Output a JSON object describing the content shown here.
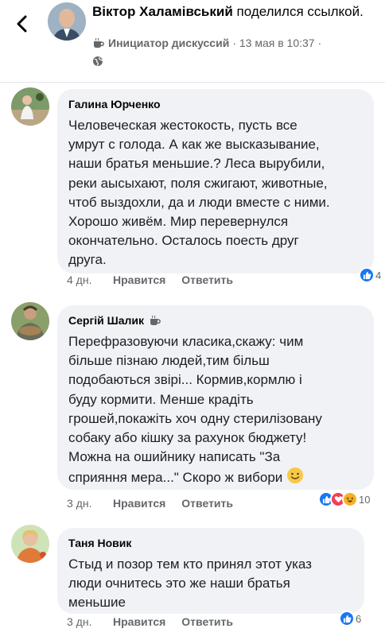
{
  "header": {
    "author": "Віктор Халамівський",
    "action": "поделился ссылкой.",
    "role": "Инициатор дискуссий",
    "timestamp": "· 13 мая в 10:37 ·"
  },
  "comments": [
    {
      "name": "Галина Юрченко",
      "text": "Человеческая жестокость, пусть все\nумрут с голода. А как же высказывание,\nнаши братья меньшие.? Леса вырубили,\nреки аысыхают, поля сжигают, животные,\nчтоб выздохли, да и люди вместе с ними.\nХорошо живём. Мир перевернулся\nокончательно. Осталось поесть друг\nдруга.",
      "time": "4 дн.",
      "like_label": "Нравится",
      "reply_label": "Ответить",
      "reaction_count": "4"
    },
    {
      "name": "Сергій Шалик",
      "text": "Перефразовуючи класика,скажу: чим\nбільше пізнаю людей,тим більш\nподобаються звірі... Кормив,кормлю і\nбуду кормити. Менше крадіть\nгрошей,покажіть хоч одну стерилізовану\nсобаку або кішку за рахунок бюджету!\nМожна на ошийнику написать \"За\nсприяння мера...\"  Скоро ж вибори",
      "time": "3 дн.",
      "like_label": "Нравится",
      "reply_label": "Ответить",
      "reaction_count": "10"
    },
    {
      "name": "Таня Новик",
      "text": "Стыд и позор тем кто принял этот указ\nлюди очнитесь это же наши братья\nменьшие",
      "time": "3 дн.",
      "like_label": "Нравится",
      "reply_label": "Ответить",
      "reaction_count": "6"
    }
  ],
  "colors": {
    "like_blue": "#1877f2",
    "love_red": "#f33e58",
    "haha_yellow": "#f7b125",
    "bubble_bg": "#f0f2f5",
    "meta_gray": "#65676b"
  },
  "icons": [
    "back-chevron-icon",
    "coffee-cup-icon",
    "globe-icon",
    "like-reaction-icon",
    "love-reaction-icon",
    "haha-reaction-icon",
    "smile-emoji-icon"
  ]
}
